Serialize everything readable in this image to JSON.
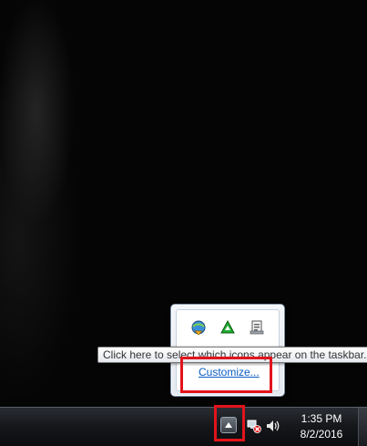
{
  "tooltip": {
    "text": "Click here to select which icons appear on the taskbar."
  },
  "flyout": {
    "icons": [
      "network-download-icon",
      "green-triangle-app-icon",
      "document-tray-icon"
    ],
    "customize_label": "Customize..."
  },
  "taskbar": {
    "show_hidden_icon": "triangle-up-icon",
    "network_icon": "network-error-icon",
    "volume_icon": "speaker-icon",
    "clock": {
      "time": "1:35 PM",
      "date": "8/2/2016"
    }
  },
  "colors": {
    "highlight": "#e2141c",
    "link": "#0a5cc2"
  }
}
